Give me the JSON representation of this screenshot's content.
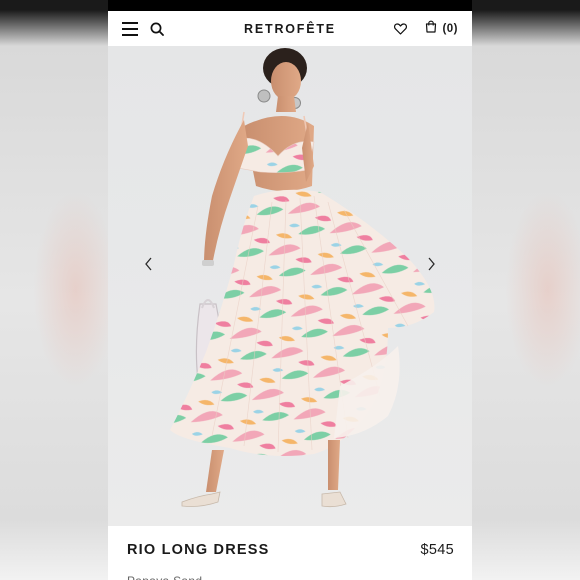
{
  "header": {
    "brand": "RETROFÊTE",
    "bag_count": "(0)"
  },
  "product": {
    "name": "RIO LONG DRESS",
    "price": "$545",
    "color": "Papaya Sand"
  },
  "icons": {
    "menu": "hamburger-menu-icon",
    "search": "search-icon",
    "wishlist": "heart-icon",
    "bag": "shopping-bag-icon",
    "prev": "chevron-left-icon",
    "next": "chevron-right-icon"
  },
  "colors": {
    "status_bar": "#000000",
    "text": "#1a1a1a",
    "print_pink": "#f2a7b8",
    "print_green": "#7ccfa5",
    "print_orange": "#f5b66a"
  }
}
